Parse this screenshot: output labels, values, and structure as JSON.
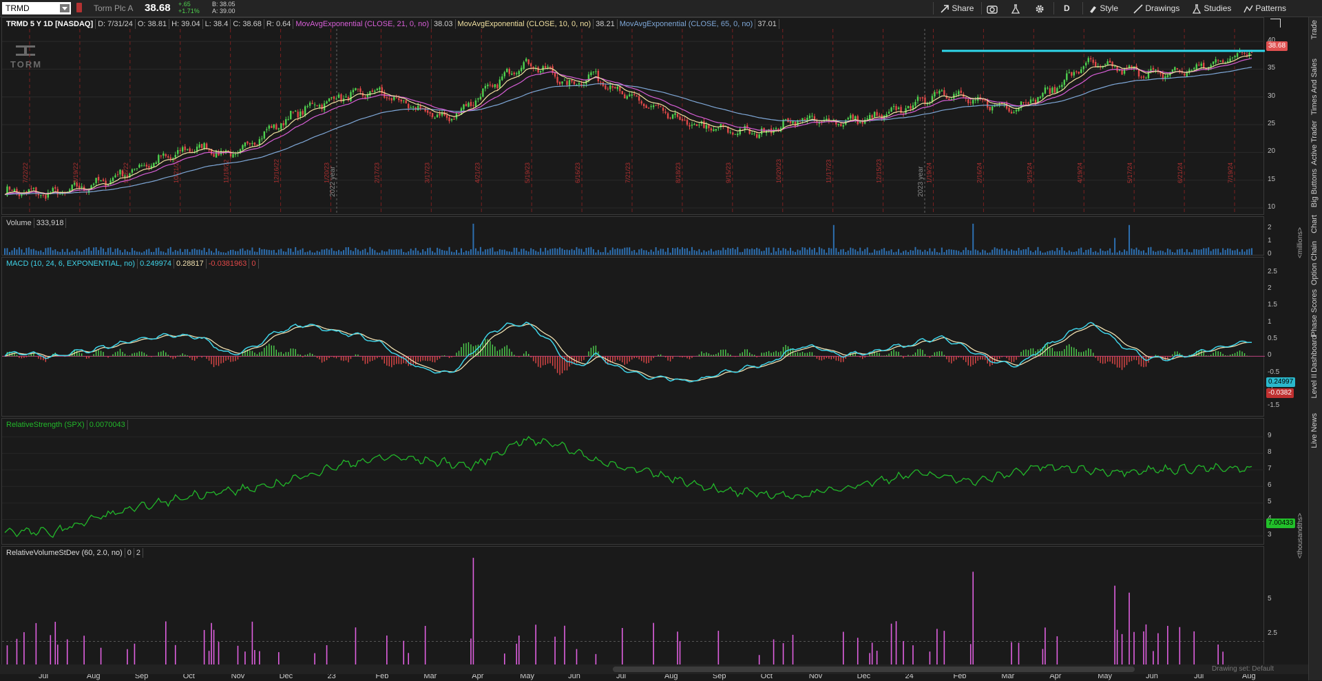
{
  "topbar": {
    "symbol": "TRMD",
    "company": "Torm Plc A",
    "last": "38.68",
    "change_net": "+.65",
    "change_pct": "+1.71%",
    "bid": "B: 38.05",
    "ask": "A: 39.00",
    "buttons": {
      "share": "Share",
      "aggregation": "D",
      "style": "Style",
      "drawings": "Drawings",
      "studies": "Studies",
      "patterns": "Patterns"
    }
  },
  "price_pane": {
    "title": "TRMD 5 Y 1D [NASDAQ]",
    "date": "D: 7/31/24",
    "open": "O: 38.81",
    "high": "H: 39.04",
    "low": "L: 38.4",
    "close": "C: 38.68",
    "range": "R: 0.64",
    "ema21_label": "MovAvgExponential (CLOSE, 21, 0, no)",
    "ema21_value": "38.03",
    "ema10_label": "MovAvgExponential (CLOSE, 10, 0, no)",
    "ema10_value": "38.21",
    "ema65_label": "MovAvgExponential (CLOSE, 65, 0, no)",
    "ema65_value": "37.01",
    "last_tag": "38.68",
    "logo_text": "TORM",
    "year_marks": [
      "2022 year",
      "2023 year"
    ],
    "ticks": [
      "40",
      "35",
      "30",
      "25",
      "20",
      "15",
      "10"
    ],
    "date_marks": [
      "7/22/22",
      "8/19/22",
      "9/16/22",
      "10/21/22",
      "11/18/22",
      "12/16/22",
      "1/20/23",
      "2/17/23",
      "3/17/23",
      "4/21/23",
      "5/19/23",
      "6/16/23",
      "7/21/23",
      "8/18/23",
      "9/15/23",
      "10/20/23",
      "11/17/23",
      "12/15/23",
      "1/19/24",
      "2/16/24",
      "3/15/24",
      "4/19/24",
      "5/17/24",
      "6/21/24",
      "7/19/24"
    ]
  },
  "volume_pane": {
    "label": "Volume",
    "value": "333,918",
    "ticks": [
      "2",
      "1",
      "0"
    ],
    "unit": "<millions>"
  },
  "macd_pane": {
    "label": "MACD (10, 24, 6, EXPONENTIAL, no)",
    "value": "0.249974",
    "avg": "0.28817",
    "diff": "-0.0381963",
    "zero": "0",
    "ticks": [
      "2.5",
      "2",
      "1.5",
      "1",
      "0.5",
      "0",
      "-0.5",
      "-1",
      "-1.5"
    ],
    "tag_value": "0.24997",
    "tag_diff": "-0.0382"
  },
  "rs_pane": {
    "label": "RelativeStrength (SPX)",
    "value": "0.0070043",
    "ticks": [
      "9",
      "8",
      "7",
      "6",
      "5",
      "4",
      "3"
    ],
    "tag": "7.00433",
    "unit": "<thousandths>"
  },
  "rvsd_pane": {
    "label": "RelativeVolumeStDev (60, 2.0, no)",
    "v1": "0",
    "v2": "2",
    "ticks": [
      "5",
      "2.5"
    ]
  },
  "x_axis": [
    "Jul",
    "Aug",
    "Sep",
    "Oct",
    "Nov",
    "Dec",
    "23",
    "Feb",
    "Mar",
    "Apr",
    "May",
    "Jun",
    "Jul",
    "Aug",
    "Sep",
    "Oct",
    "Nov",
    "Dec",
    "24",
    "Feb",
    "Mar",
    "Apr",
    "May",
    "Jun",
    "Jul",
    "Aug"
  ],
  "bottom": {
    "drawing_set": "Drawing set: Default"
  },
  "right_tabs": [
    "Trade",
    "Times And Sales",
    "Active Trader",
    "Big Buttons",
    "Chart",
    "Option Chain",
    "Phase Scores",
    "Dashboard",
    "Level II",
    "Live News"
  ],
  "colors": {
    "up": "#4fd14f",
    "down": "#e04848",
    "ema21": "#d85fd8",
    "ema10": "#f0e0a0",
    "ema65": "#7fa8d8",
    "macd": "#3fd3e8",
    "macd_avg": "#f0e0b0",
    "rs": "#22b82a",
    "hline": "#2fd8ec",
    "tag_price": "#e05050"
  }
}
